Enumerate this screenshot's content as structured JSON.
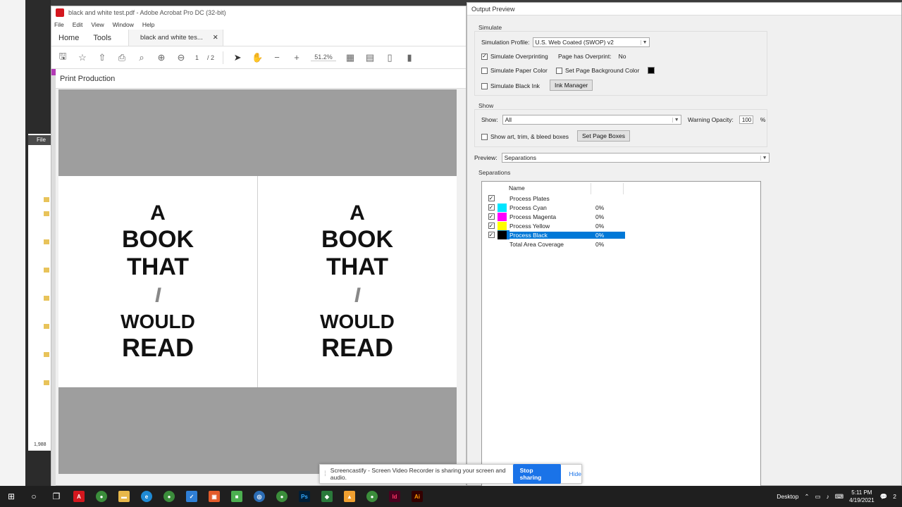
{
  "acrobat": {
    "window_title": "black and white test.pdf - Adobe Acrobat Pro DC (32-bit)",
    "menu": [
      "File",
      "Edit",
      "View",
      "Window",
      "Help"
    ],
    "tabs": {
      "home": "Home",
      "tools": "Tools",
      "doc": "black and white tes..."
    },
    "page_current": "1",
    "page_total": "/ 2",
    "zoom": "51.2%",
    "print_production": "Print Production",
    "page_words": [
      "A",
      "BOOK",
      "THAT",
      "I",
      "WOULD",
      "READ"
    ]
  },
  "output_preview": {
    "title": "Output Preview",
    "simulate_label": "Simulate",
    "simulation_profile_label": "Simulation Profile:",
    "simulation_profile_value": "U.S. Web Coated (SWOP) v2",
    "simulate_overprinting": "Simulate Overprinting",
    "page_has_overprint_label": "Page has Overprint:",
    "page_has_overprint_value": "No",
    "simulate_paper_color": "Simulate Paper Color",
    "set_page_bg_color": "Set Page Background Color",
    "simulate_black_ink": "Simulate Black Ink",
    "ink_manager": "Ink Manager",
    "show_group": "Show",
    "show_label": "Show:",
    "show_value": "All",
    "warning_opacity_label": "Warning Opacity:",
    "warning_opacity_value": "100",
    "percent": "%",
    "show_boxes": "Show art, trim, & bleed boxes",
    "set_page_boxes": "Set Page Boxes",
    "preview_label": "Preview:",
    "preview_value": "Separations",
    "separations_label": "Separations",
    "col_name": "Name",
    "rows": [
      {
        "name": "Process Plates",
        "pct": "",
        "color": ""
      },
      {
        "name": "Process Cyan",
        "pct": "0%",
        "color": "#00e5ff"
      },
      {
        "name": "Process Magenta",
        "pct": "0%",
        "color": "#ff00ff"
      },
      {
        "name": "Process Yellow",
        "pct": "0%",
        "color": "#ffff00"
      },
      {
        "name": "Process Black",
        "pct": "0%",
        "color": "#000000"
      },
      {
        "name": "Total Area Coverage",
        "pct": "0%",
        "color": ""
      }
    ]
  },
  "screencastify": {
    "message": "Screencastify - Screen Video Recorder is sharing your screen and audio.",
    "stop": "Stop sharing",
    "hide": "Hide"
  },
  "taskbar": {
    "desktop": "Desktop",
    "time": "5:11 PM",
    "date": "4/19/2021",
    "notif": "2"
  },
  "bg_left": {
    "file_label": "File",
    "count": "1,988"
  },
  "colors": {
    "accent": "#0078d7",
    "selection": "#0078d7",
    "print_production_bar": "#b33bb5"
  }
}
